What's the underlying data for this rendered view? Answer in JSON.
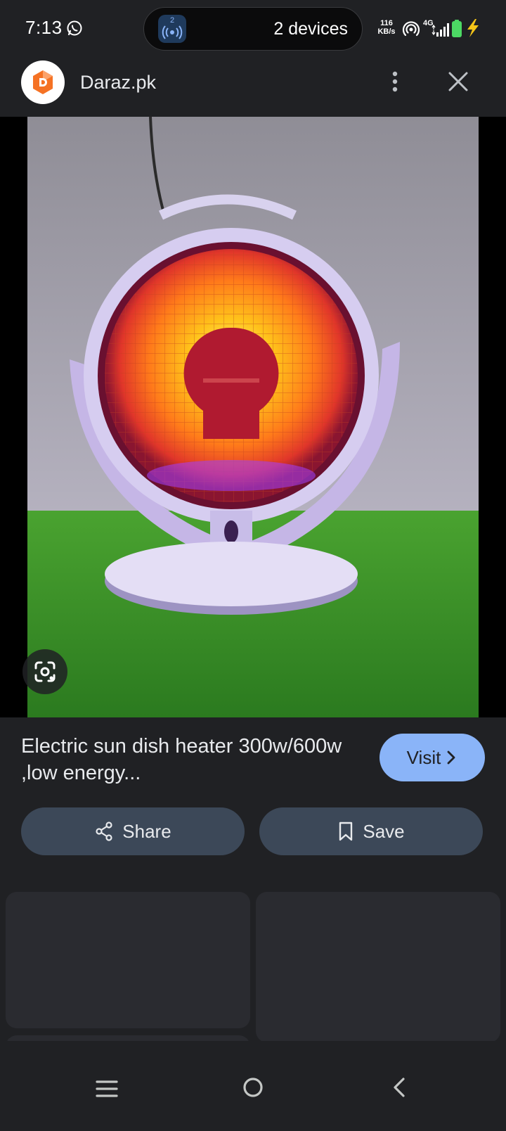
{
  "status_bar": {
    "time": "7:13",
    "devices_text": "2 devices",
    "device_count_badge": "2",
    "speed_value": "116",
    "speed_unit": "KB/s",
    "network": "4G",
    "icons": [
      "whatsapp-icon",
      "hotspot-icon",
      "signal-icon",
      "battery-icon",
      "charging-bolt-icon"
    ]
  },
  "header": {
    "site_name": "Daraz.pk",
    "logo": "daraz-logo",
    "menu_icon": "more-vert-icon",
    "close_icon": "close-icon"
  },
  "image": {
    "subject": "Electric sun dish heater",
    "lens_icon": "google-lens-icon"
  },
  "info": {
    "title": "Electric sun dish heater 300w/600w ,low energy...",
    "visit_label": "Visit",
    "share_label": "Share",
    "save_label": "Save"
  },
  "colors": {
    "background": "#202124",
    "visit_button": "#8ab4f8",
    "action_button": "#3c4858",
    "card": "#2a2b30"
  },
  "nav": {
    "icons": [
      "recents-icon",
      "home-icon",
      "back-icon"
    ]
  }
}
